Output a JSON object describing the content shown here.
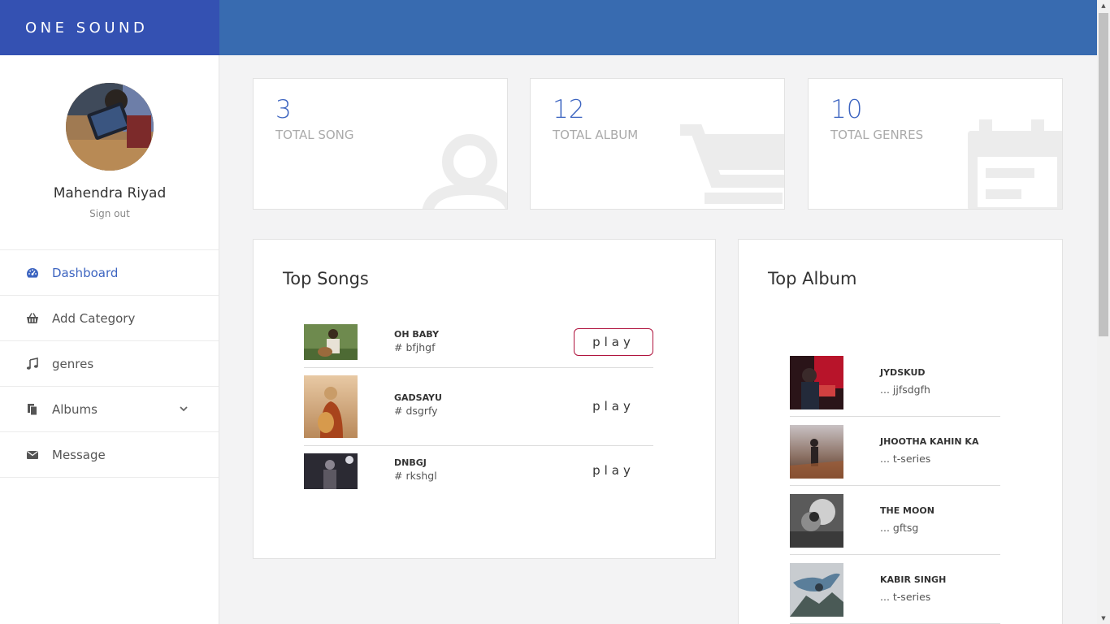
{
  "brand": {
    "title": "ONE SOUND"
  },
  "user": {
    "name": "Mahendra Riyad",
    "signout_label": "Sign out"
  },
  "menu": [
    {
      "label": "Dashboard",
      "icon": "dashboard-icon",
      "active": true
    },
    {
      "label": "Add Category",
      "icon": "basket-icon"
    },
    {
      "label": "genres",
      "icon": "music-note-icon"
    },
    {
      "label": "Albums",
      "icon": "copy-icon",
      "has_dropdown": true
    },
    {
      "label": "Message",
      "icon": "envelope-icon"
    }
  ],
  "stats": [
    {
      "value": "3",
      "label": "TOTAL SONG",
      "icon": "user-icon"
    },
    {
      "value": "12",
      "label": "TOTAL ALBUM",
      "icon": "cart-icon"
    },
    {
      "value": "10",
      "label": "TOTAL GENRES",
      "icon": "calendar-icon"
    }
  ],
  "top_songs": {
    "title": "Top Songs",
    "items": [
      {
        "title": "OH BABY",
        "tag": "# bfjhgf",
        "play_label": "play"
      },
      {
        "title": "GADSAYU",
        "tag": "# dsgrfy",
        "play_label": "play"
      },
      {
        "title": "DNBGJ",
        "tag": "# rkshgl",
        "play_label": "play"
      }
    ]
  },
  "top_album": {
    "title": "Top Album",
    "items": [
      {
        "title": "JYDSKUD",
        "sub": "... jjfsdgfh"
      },
      {
        "title": "JHOOTHA KAHIN KA",
        "sub": "... t-series"
      },
      {
        "title": "THE MOON",
        "sub": "... gftsg"
      },
      {
        "title": "KABIR SINGH",
        "sub": "... t-series"
      }
    ]
  },
  "colors": {
    "brand": "#3451b2",
    "topbar": "#386bb0",
    "accent": "#3c64c0",
    "play_outline": "#b0143e"
  }
}
